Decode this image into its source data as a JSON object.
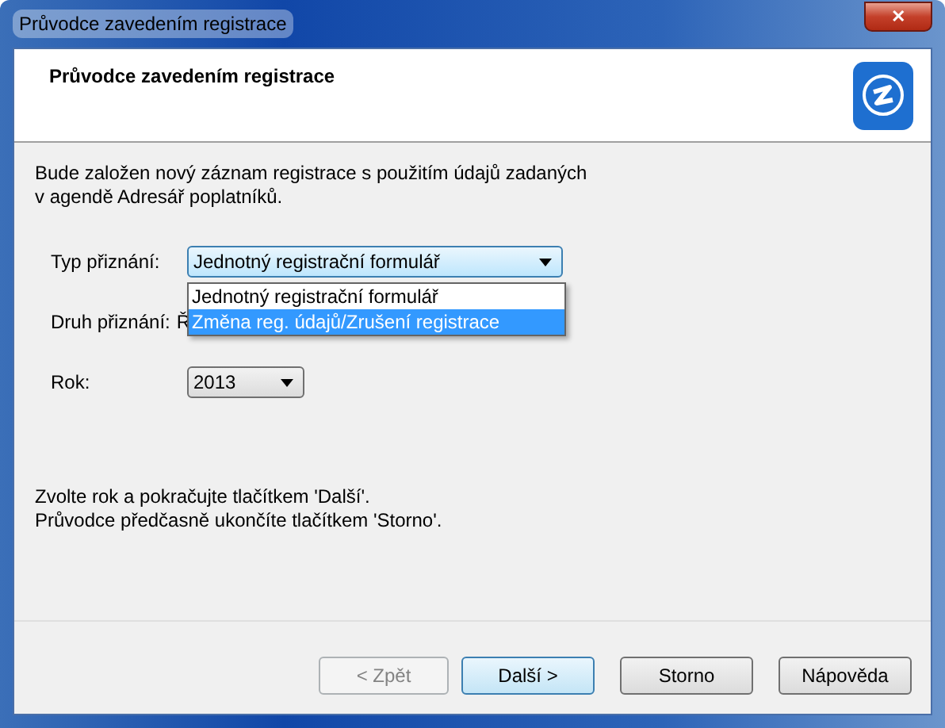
{
  "window": {
    "title": "Průvodce zavedením registrace",
    "close": "✕"
  },
  "header": {
    "title": "Průvodce zavedením registrace"
  },
  "intro": [
    "Bude založen nový záznam registrace s použitím údajů zadaných",
    "v agendě Adresář poplatníků."
  ],
  "fields": [
    {
      "kind": "combo",
      "label": "Typ přiznání:",
      "value": "Jednotný registrační formulář",
      "expanded": true,
      "options": [
        {
          "label": "Jednotný registrační formulář",
          "highlighted": false
        },
        {
          "label": "Změna reg. údajů/Zrušení registrace",
          "highlighted": true
        }
      ]
    },
    {
      "kind": "text",
      "label": "Druh přiznání:",
      "value": "Ř"
    },
    {
      "kind": "combo",
      "label": "Rok:",
      "value": "2013",
      "expanded": false
    }
  ],
  "instructions": [
    "Zvolte rok a pokračujte tlačítkem 'Další'.",
    "Průvodce předčasně ukončíte tlačítkem 'Storno'."
  ],
  "buttons": [
    {
      "label": "< Zpět",
      "disabled": true,
      "default": false
    },
    {
      "label": "Další >",
      "disabled": false,
      "default": true
    },
    {
      "label": "Storno",
      "disabled": false,
      "default": false
    },
    {
      "label": "Nápověda",
      "disabled": false,
      "default": false
    }
  ]
}
